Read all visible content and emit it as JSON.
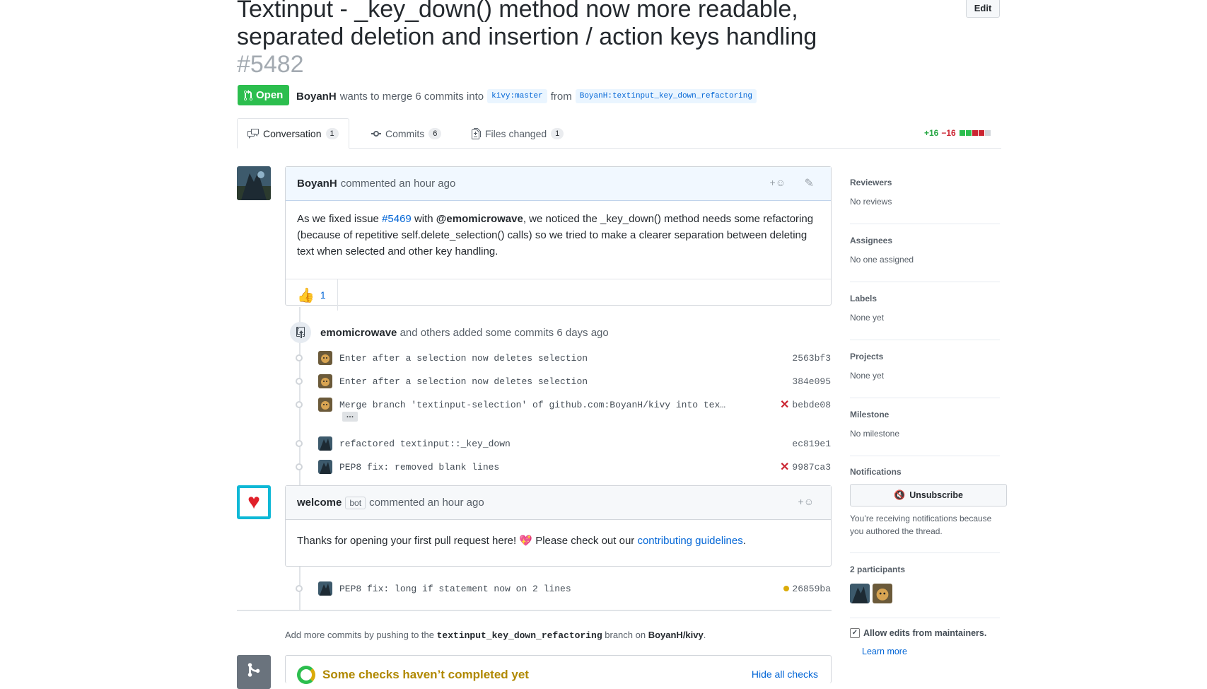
{
  "header": {
    "title": "Textinput - _key_down() method now more readable, separated deletion and insertion / action keys handling",
    "number": "#5482",
    "edit_label": "Edit",
    "state": "Open",
    "author": "BoyanH",
    "merge_text": "wants to merge 6 commits into",
    "base_ref": "kivy:master",
    "from_text": "from",
    "head_ref": "BoyanH:textinput_key_down_refactoring"
  },
  "tabs": [
    {
      "label": "Conversation",
      "count": "1"
    },
    {
      "label": "Commits",
      "count": "6"
    },
    {
      "label": "Files changed",
      "count": "1"
    }
  ],
  "diffstat": {
    "additions": "+16",
    "deletions": "−16",
    "colors": {
      "add": "#2cbe4e",
      "del": "#cb2431",
      "neutral": "#d1d5da"
    }
  },
  "comment1": {
    "author": "BoyanH",
    "meta": "commented an hour ago",
    "body_prefix": "As we fixed issue ",
    "issue_link": "#5469",
    "body_mid": " with ",
    "mention": "@emomicrowave",
    "body_suffix": ", we noticed the _key_down() method needs some refactoring (because of repetitive self.delete_selection() calls) so we tried to make a clearer separation between deleting text when selected and other key handling.",
    "reaction_emoji": "👍",
    "reaction_count": "1"
  },
  "commit_group": {
    "actor": "emomicrowave",
    "text": "and others added some commits 6 days ago"
  },
  "commits": [
    {
      "message": "Enter after a selection now deletes selection",
      "sha": "2563bf3",
      "status": "",
      "avatar": "doge"
    },
    {
      "message": "Enter after a selection now deletes selection",
      "sha": "384e095",
      "status": "",
      "avatar": "doge"
    },
    {
      "message": "Merge branch 'textinput-selection' of github.com:BoyanH/kivy into tex…",
      "sha": "bebde08",
      "status": "✕",
      "avatar": "doge",
      "ellipsis": "…"
    },
    {
      "message": "refactored textinput::_key_down",
      "sha": "ec819e1",
      "status": "",
      "avatar": "boyan"
    },
    {
      "message": "PEP8 fix: removed blank lines",
      "sha": "9987ca3",
      "status": "✕",
      "avatar": "boyan"
    }
  ],
  "comment2": {
    "author": "welcome",
    "badge": "bot",
    "meta": "commented an hour ago",
    "body_prefix": "Thanks for opening your first pull request here! ",
    "emoji": "💖",
    "body_mid": " Please check out our ",
    "link": "contributing guidelines",
    "body_suffix": "."
  },
  "last_commit": {
    "message": "PEP8 fix: long if statement now on 2 lines",
    "sha": "26859ba",
    "status": "pending"
  },
  "push_hint": {
    "prefix": "Add more commits by pushing to the ",
    "branch": "textinput_key_down_refactoring",
    "mid": " branch on ",
    "repo": "BoyanH/kivy",
    "suffix": "."
  },
  "checks": {
    "title": "Some checks haven’t completed yet",
    "toggle": "Hide all checks"
  },
  "sidebar": {
    "reviewers": {
      "heading": "Reviewers",
      "value": "No reviews"
    },
    "assignees": {
      "heading": "Assignees",
      "value": "No one assigned"
    },
    "labels": {
      "heading": "Labels",
      "value": "None yet"
    },
    "projects": {
      "heading": "Projects",
      "value": "None yet"
    },
    "milestone": {
      "heading": "Milestone",
      "value": "No milestone"
    },
    "notifications": {
      "heading": "Notifications",
      "button": "Unsubscribe",
      "reason": "You’re receiving notifications because you authored the thread."
    },
    "participants": {
      "heading": "2 participants"
    },
    "allow_edits": {
      "label": "Allow edits from maintainers.",
      "learn_more": "Learn more",
      "checked": true
    }
  }
}
